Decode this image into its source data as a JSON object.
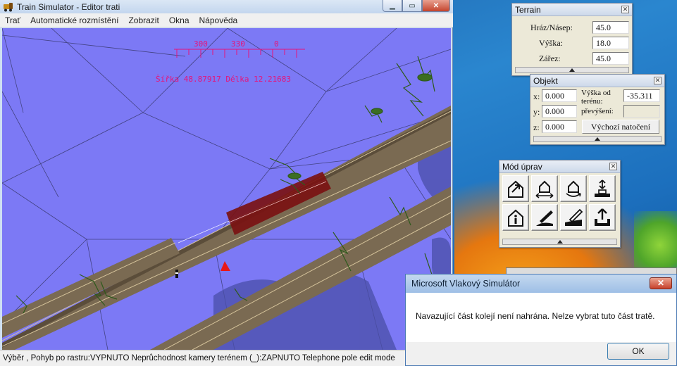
{
  "main_window": {
    "title": "Train Simulator - Editor trati",
    "menu": [
      "Trať",
      "Automatické rozmístění",
      "Zobrazit",
      "Okna",
      "Nápověda"
    ],
    "compass": {
      "ticks": [
        "300",
        "330",
        "0"
      ]
    },
    "coords": "Šířka 48.87917 Délka 12.21683",
    "status": "Výběr , Pohyb po rastru:VYPNUTO Neprůchodnost kamery terénem (_):ZAPNUTO Telephone pole edit mode"
  },
  "terrain_panel": {
    "title": "Terrain",
    "rows": [
      {
        "label": "Hráz/Násep:",
        "value": "45.0"
      },
      {
        "label": "Výška:",
        "value": "18.0"
      },
      {
        "label": "Zářez:",
        "value": "45.0"
      }
    ]
  },
  "objekt_panel": {
    "title": "Objekt",
    "x_label": "x:",
    "x_value": "0.000",
    "y_label": "y:",
    "y_value": "0.000",
    "z_label": "z:",
    "z_value": "0.000",
    "height_label": "Výška od terénu:",
    "height_value": "-35.311",
    "elev_label": "převýšení:",
    "elev_value": "",
    "reset_button": "Výchozí natočení"
  },
  "edit_mode_panel": {
    "title": "Mód úprav",
    "tools": [
      "select-tool-icon",
      "move-horizontal-icon",
      "rotate-icon",
      "raise-lower-icon",
      "info-icon",
      "pen-tool-icon",
      "pencil-tool-icon",
      "upload-icon"
    ]
  },
  "dialog": {
    "title": "Microsoft Vlakový Simulátor",
    "message": "Navazující část kolejí není nahrána. Nelze vybrat tuto část tratě.",
    "ok_label": "OK"
  }
}
